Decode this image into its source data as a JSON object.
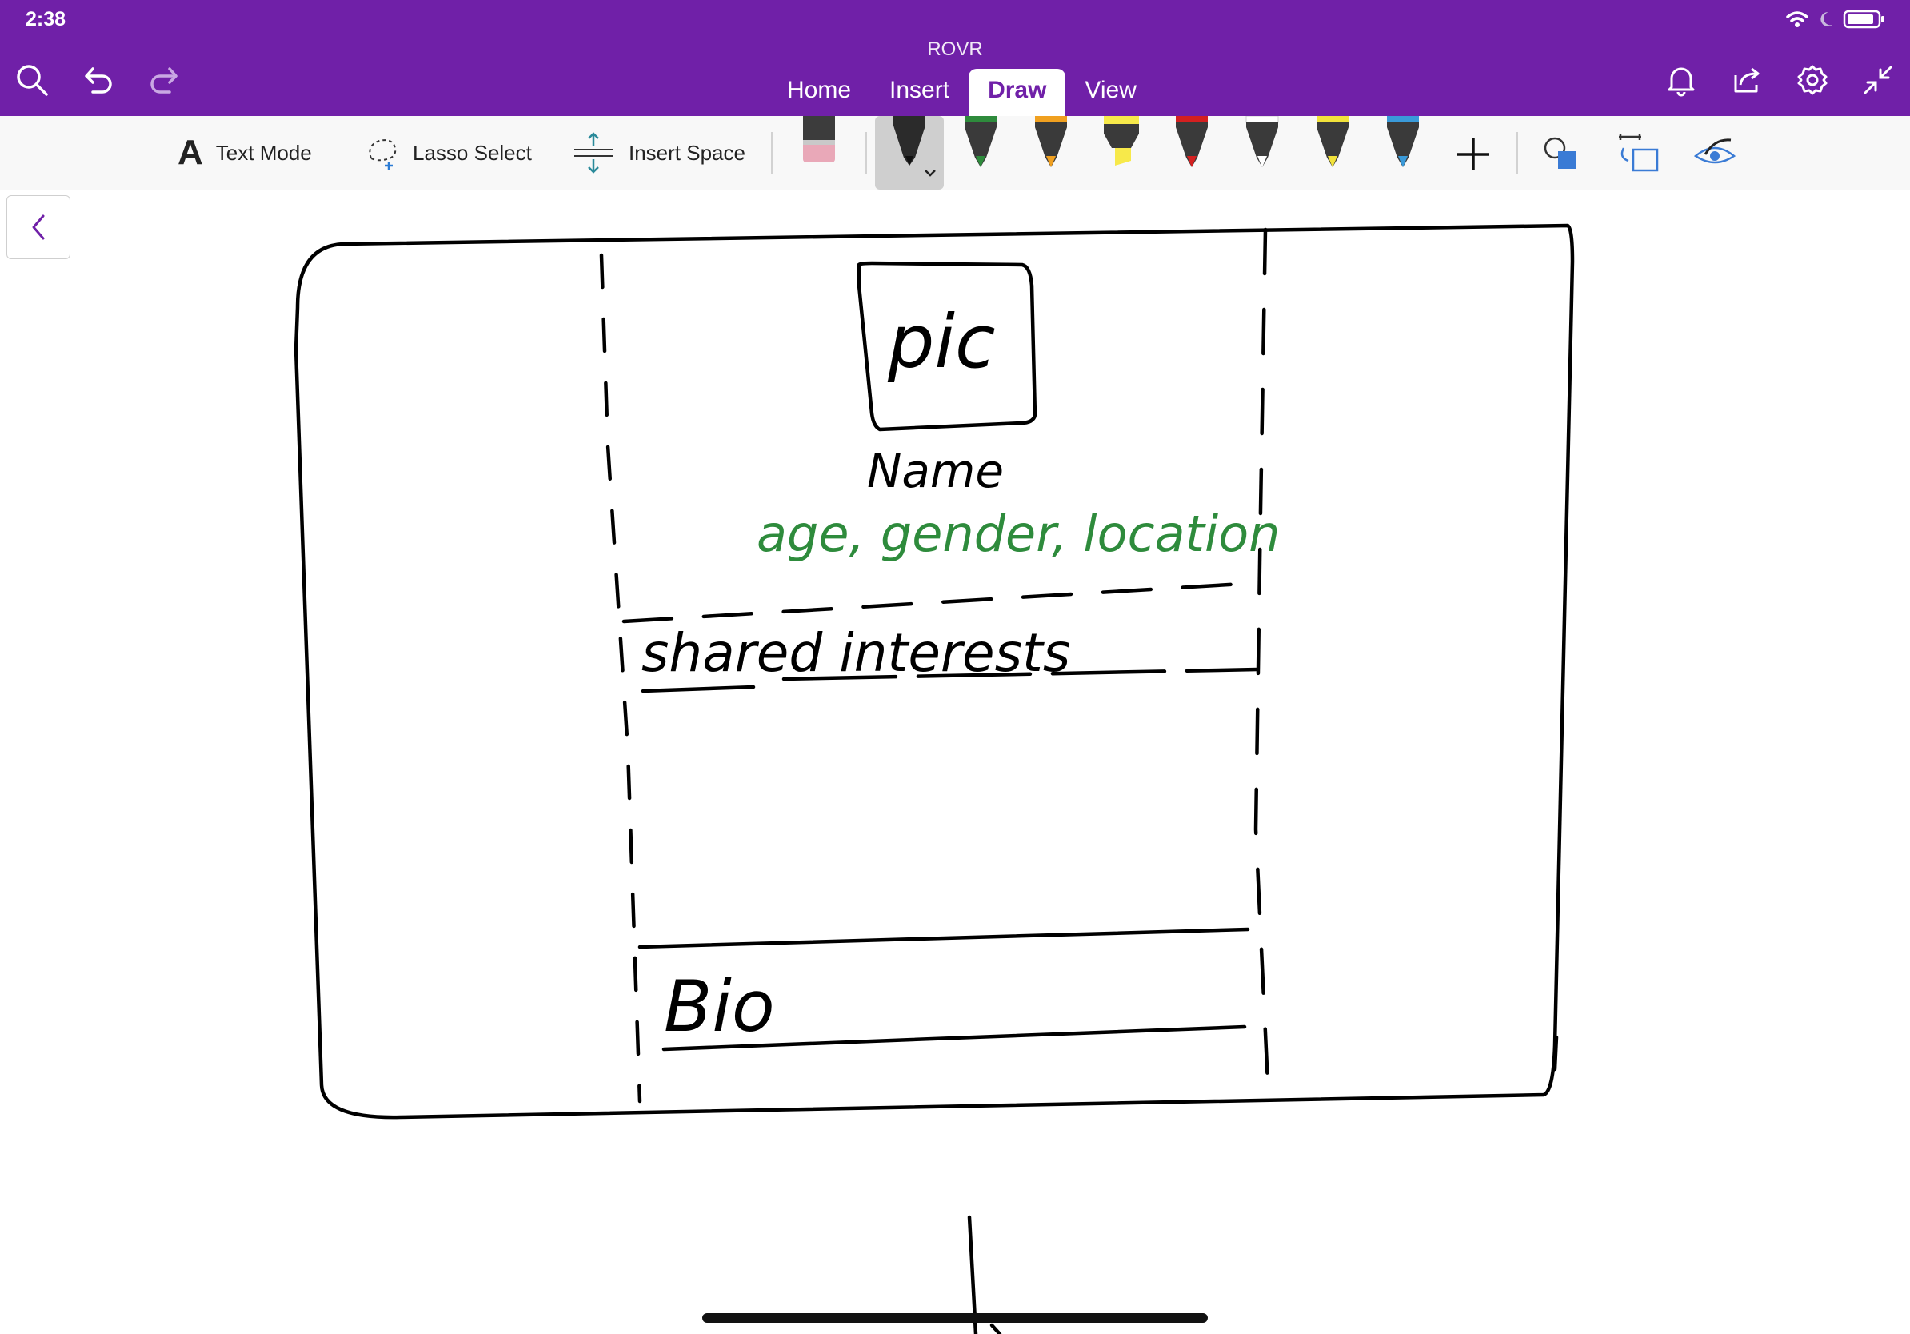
{
  "status": {
    "time": "2:38"
  },
  "app": {
    "title": "ROVR"
  },
  "tabs": [
    {
      "label": "Home"
    },
    {
      "label": "Insert"
    },
    {
      "label": "Draw"
    },
    {
      "label": "View"
    }
  ],
  "ribbon": {
    "text_mode": "Text Mode",
    "lasso_select": "Lasso Select",
    "insert_space": "Insert Space"
  },
  "pens": [
    {
      "name": "eraser",
      "color": "#e9a8b8"
    },
    {
      "name": "black-pen",
      "color": "#111111"
    },
    {
      "name": "green-pen",
      "color": "#2e8b3c"
    },
    {
      "name": "orange-pen",
      "color": "#f0a020"
    },
    {
      "name": "yellow-highlighter",
      "color": "#f7e94a"
    },
    {
      "name": "red-pen",
      "color": "#d42020"
    },
    {
      "name": "white-pen",
      "color": "#ffffff"
    },
    {
      "name": "yellow-pen",
      "color": "#f2e23a"
    },
    {
      "name": "blue-pen",
      "color": "#3a9ad9"
    }
  ],
  "colors": {
    "accent": "#7020a8",
    "ink": "#000000",
    "green_ink": "#2e8b3c"
  },
  "sketch": {
    "pic": "pic",
    "name": "Name",
    "details": "age, gender, location",
    "shared_interests": "shared interests",
    "bio": "Bio"
  }
}
